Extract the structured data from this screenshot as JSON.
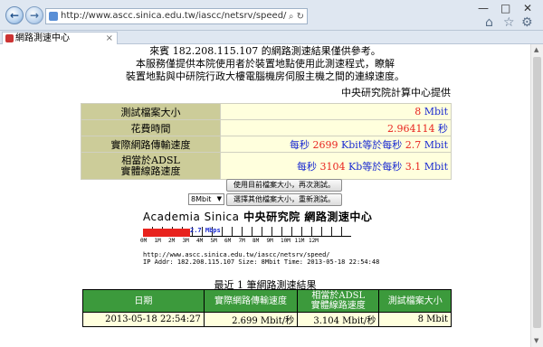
{
  "browser": {
    "url": "http://www.ascc.sinica.edu.tw/iascc/netsrv/speed/",
    "tab_title": "網路測速中心",
    "back": "←",
    "forward": "→",
    "refresh": "↻",
    "search": "⌕",
    "min": "—",
    "max": "□",
    "close": "✕",
    "home": "⌂",
    "star": "☆",
    "gear": "⚙"
  },
  "intro": {
    "line1": "來賓 182.208.115.107 的網路測速結果僅供參考。",
    "line2": "本服務僅提供本院使用者於裝置地點使用此測速程式，瞭解",
    "line3": "裝置地點與中研院行政大樓電腦機房伺服主機之間的連線速度。",
    "provider": "中央研究院計算中心提供"
  },
  "results": {
    "size_label": "測試檔案大小",
    "size_value": "8",
    "size_unit": "Mbit",
    "time_label": "花費時間",
    "time_value": "2.964114",
    "time_unit": "秒",
    "speed_label": "實際網路傳輸速度",
    "speed_prefix1": "每秒",
    "speed_kbit": "2699",
    "speed_mid": "Kbit等於",
    "speed_prefix2": "每秒",
    "speed_mbit": "2.7",
    "speed_unit": "Mbit",
    "adsl_label1": "相當於ADSL",
    "adsl_label2": "實體線路速度",
    "adsl_prefix1": "每秒",
    "adsl_kb": "3104",
    "adsl_mid": "Kb等於",
    "adsl_prefix2": "每秒",
    "adsl_mbit": "3.1",
    "adsl_unit": "Mbit"
  },
  "buttons": {
    "retest": "使用目前檔案大小，再次測試。",
    "select_value": "8Mbit",
    "retest_other": "選擇其他檔案大小，重新測試。"
  },
  "graph": {
    "title_en": "Academia Sinica",
    "title_zh": "中央研究院 網路測速中心",
    "speed_text": "2.7 Mbps",
    "speed_fraction": 0.225,
    "ticks": [
      "0M",
      "1M",
      "2M",
      "3M",
      "4M",
      "5M",
      "6M",
      "7M",
      "8M",
      "9M",
      "10M",
      "11M",
      "12M"
    ],
    "url": "http://www.ascc.sinica.edu.tw/iascc/netsrv/speed/",
    "ip_info": "IP Addr: 182.208.115.107 Size: 8Mbit Time: 2013-05-18 22:54:48"
  },
  "history": {
    "title": "最近 1 筆網路測速結果",
    "headers": [
      "日期",
      "實際網路傳輸速度",
      "相當於ADSL\n實體線路速度",
      "測試檔案大小"
    ],
    "rows": [
      [
        "2013-05-18 22:54:27",
        "2.699 Mbit/秒",
        "3.104 Mbit/秒",
        "8 Mbit"
      ]
    ]
  }
}
